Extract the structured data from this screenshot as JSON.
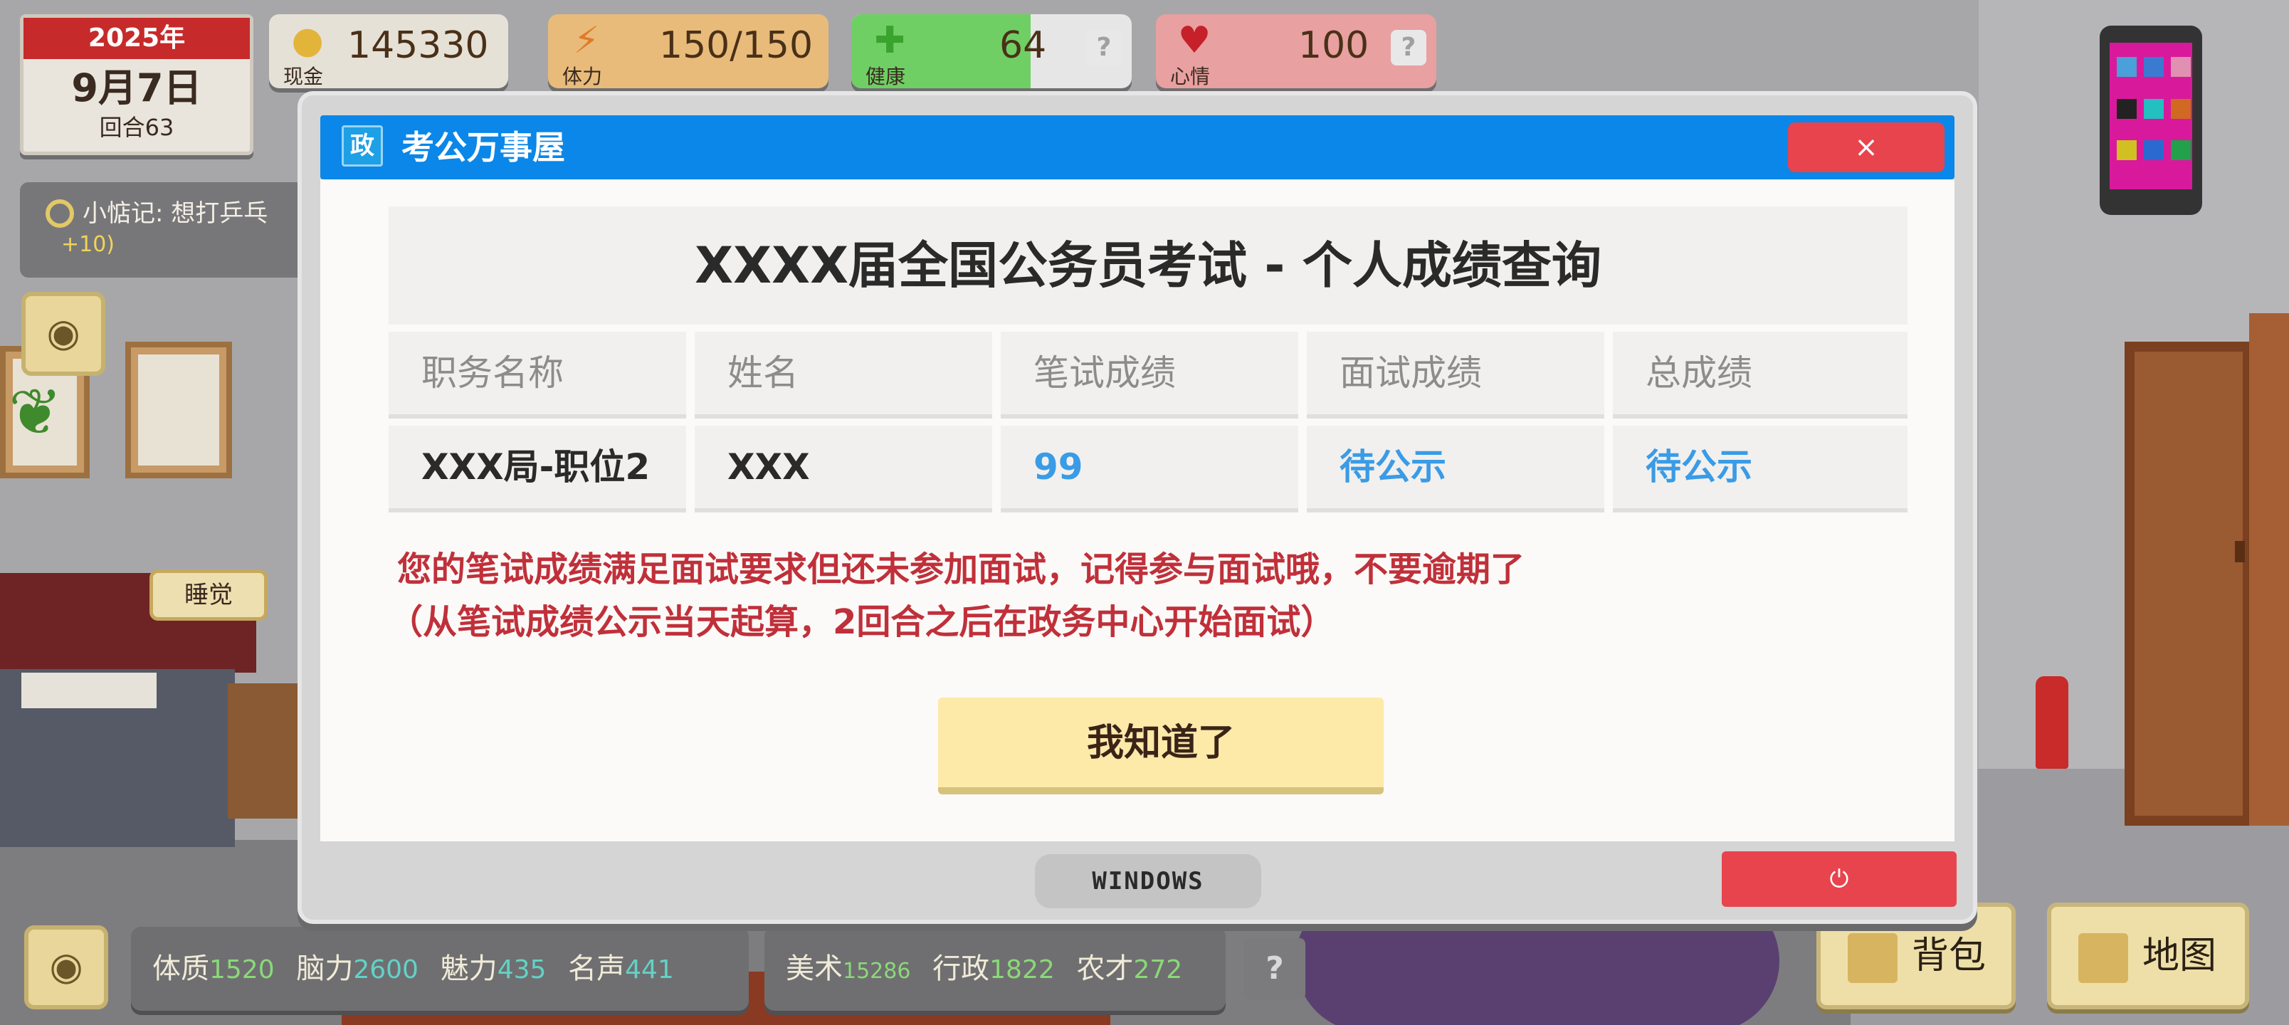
{
  "hud": {
    "calendar": {
      "year": "2025年",
      "date": "9月7日",
      "round": "回合63"
    },
    "cash": {
      "label": "现金",
      "value": "145330"
    },
    "energy": {
      "label": "体力",
      "value": "150/150"
    },
    "health": {
      "label": "健康",
      "value": "64",
      "help": "?",
      "fill_fraction": 0.64
    },
    "mood": {
      "label": "心情",
      "value": "100",
      "help": "?"
    },
    "reminder": {
      "text": "小惦记: 想打乒乓",
      "bonus": "+10)"
    },
    "sleep_label": "睡觉"
  },
  "attributes": {
    "group1": [
      {
        "name": "体质",
        "value": "1520"
      },
      {
        "name": "脑力",
        "value": "2600"
      },
      {
        "name": "魅力",
        "value": "435"
      },
      {
        "name": "名声",
        "value": "441"
      }
    ],
    "group2": [
      {
        "name": "美术",
        "value": "15286"
      },
      {
        "name": "行政",
        "value": "1822"
      },
      {
        "name": "农才",
        "value": "272"
      }
    ],
    "help": "?"
  },
  "buttons": {
    "backpack": "背包",
    "map": "地图"
  },
  "window": {
    "badge": "政",
    "title": "考公万事屋",
    "close": "×",
    "panel_title": "XXXX届全国公务员考试 - 个人成绩查询",
    "table": {
      "headers": [
        "职务名称",
        "姓名",
        "笔试成绩",
        "面试成绩",
        "总成绩"
      ],
      "row": [
        "XXX局-职位2",
        "XXX",
        "99",
        "待公示",
        "待公示"
      ]
    },
    "notice_line1": "您的笔试成绩满足面试要求但还未参加面试，记得参与面试哦，不要逾期了",
    "notice_line2": "（从笔试成绩公示当天起算，2回合之后在政务中心开始面试）",
    "ok_button": "我知道了",
    "taskbar_label": "WINDOWS",
    "power_icon": "⏻"
  },
  "colors": {
    "titlebar": "#0a87e8",
    "close": "#e8444d",
    "notice": "#c0303a",
    "pending_blue": "#3a9be6",
    "ok_button": "#fde9a8"
  },
  "icons": [
    "coin-icon",
    "lightning-icon",
    "plus-icon",
    "heart-icon",
    "eye-icon",
    "phone-icon",
    "bag-icon",
    "map-icon",
    "power-icon"
  ]
}
